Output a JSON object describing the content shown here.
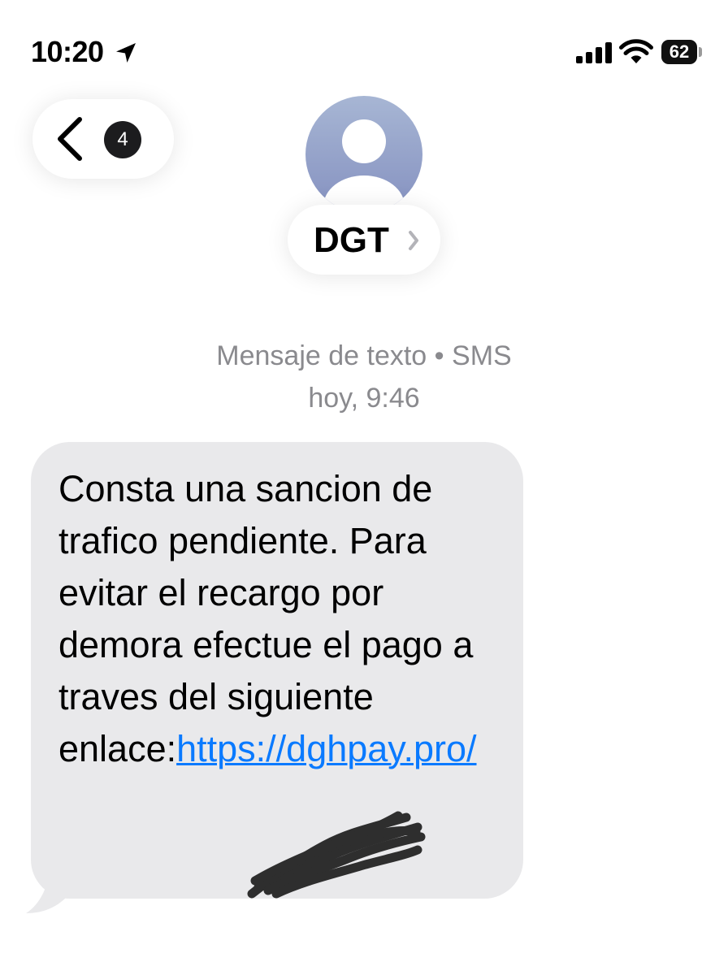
{
  "status_bar": {
    "time": "10:20",
    "battery_level": "62",
    "icons": [
      "location-arrow-icon",
      "cellular-signal-icon",
      "wifi-icon",
      "battery-icon"
    ]
  },
  "nav": {
    "back_icon": "chevron-left-icon",
    "unread_count": "4"
  },
  "contact": {
    "name": "DGT",
    "avatar_icon": "person-silhouette-icon",
    "chevron_icon": "chevron-right-icon"
  },
  "thread_meta": {
    "line1": "Mensaje de texto • SMS",
    "line2": "hoy, 9:46"
  },
  "message": {
    "body": "Consta una sancion de trafico pendiente. Para evitar el recargo por demora efectue el pago a traves del siguiente enlace:",
    "link_text": "https://​dghpay.pro/"
  },
  "colors": {
    "bubble_received": "#e9e9eb",
    "link": "#0a7aff",
    "meta_text": "#8a8a8e",
    "avatar_top": "#a7b6d4",
    "avatar_bottom": "#8591c0"
  }
}
